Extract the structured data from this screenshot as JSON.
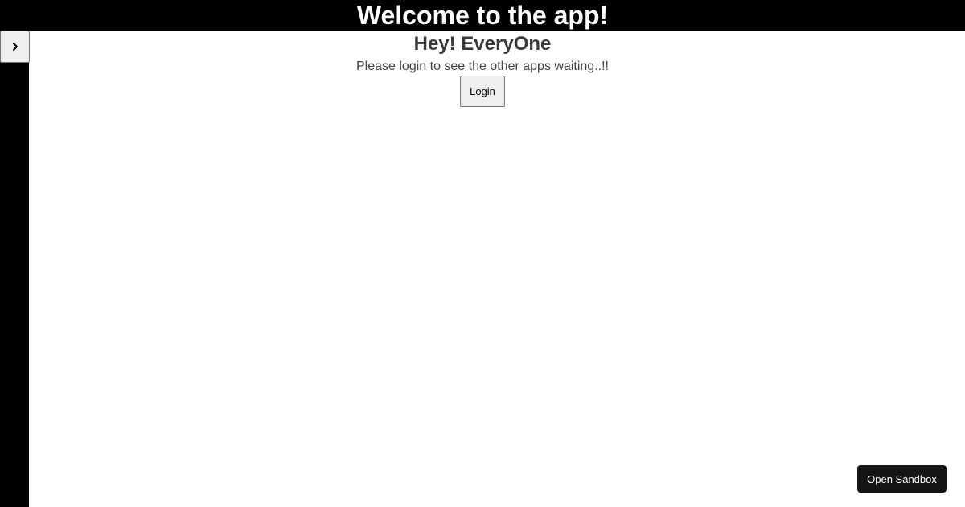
{
  "header": {
    "title": "Welcome to the app!"
  },
  "sidebar": {
    "toggle_icon": "chevron-right-icon"
  },
  "main": {
    "title": "Hey! EveryOne",
    "subtitle": "Please login to see the other apps waiting..!!",
    "login_label": "Login"
  },
  "sandbox": {
    "open_label": "Open Sandbox"
  },
  "colors": {
    "header_background": "#000000",
    "header_text": "#ffffff",
    "page_background": "#ffffff",
    "sandbox_button_background": "#151515"
  }
}
